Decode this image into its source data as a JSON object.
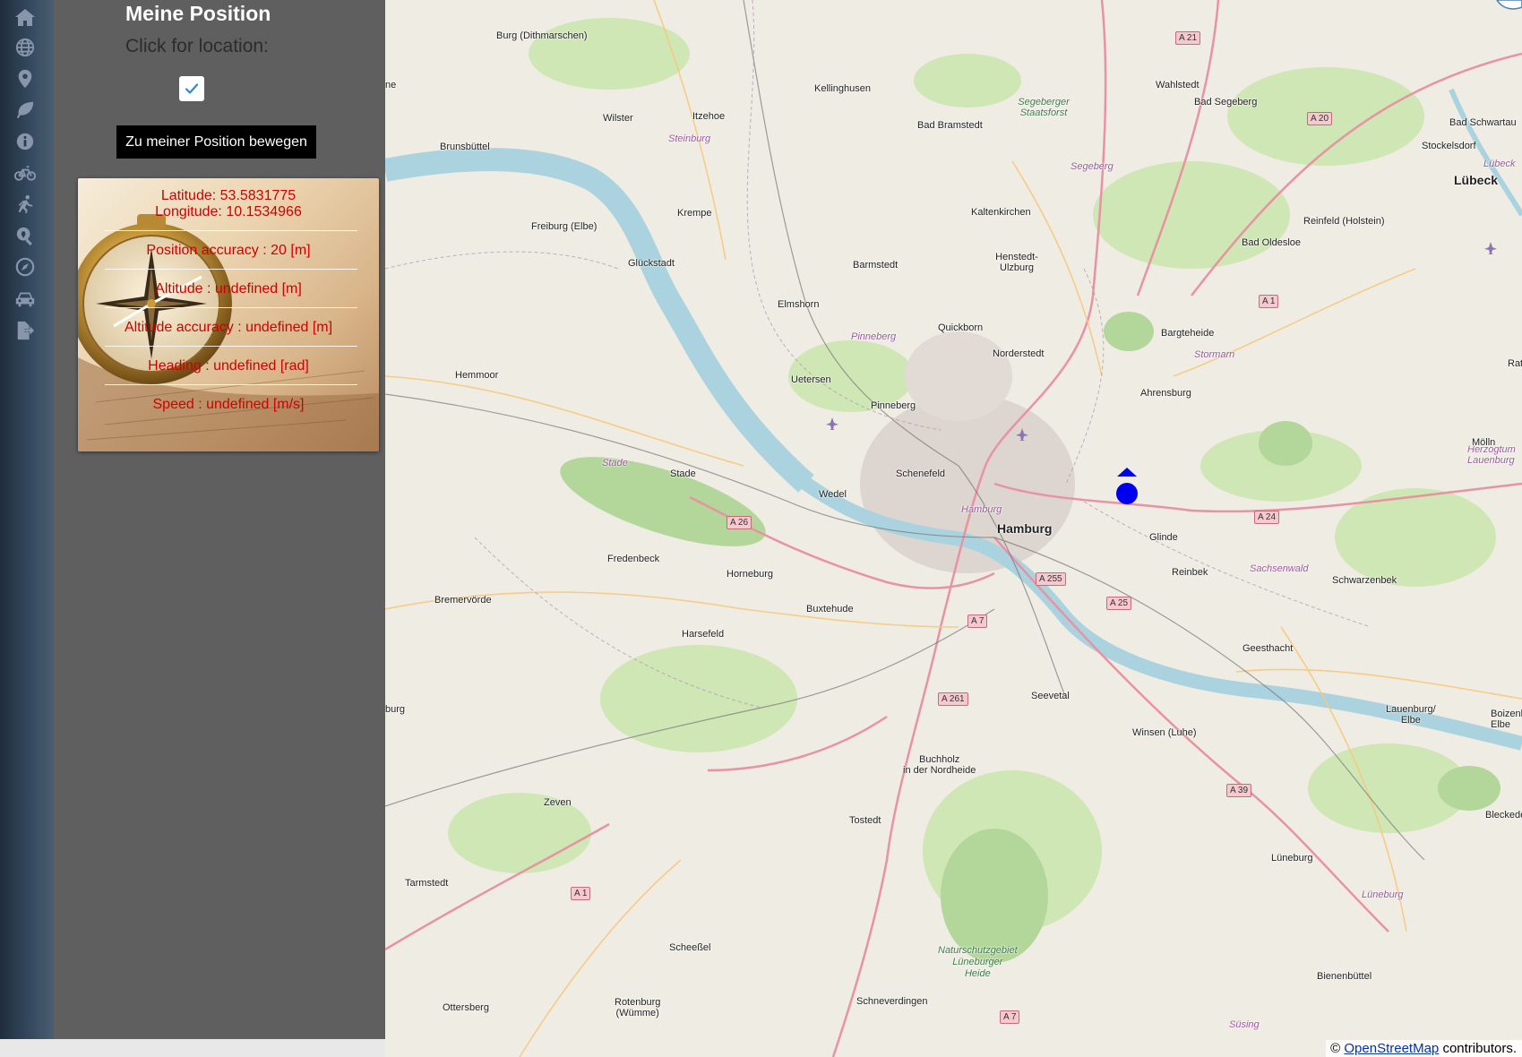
{
  "sidebar": {
    "icons": [
      {
        "name": "home-icon"
      },
      {
        "name": "globe-icon"
      },
      {
        "name": "map-marker-icon"
      },
      {
        "name": "leaf-icon"
      },
      {
        "name": "info-icon"
      },
      {
        "name": "bicycle-icon"
      },
      {
        "name": "running-icon"
      },
      {
        "name": "search-location-icon"
      },
      {
        "name": "compass-icon"
      },
      {
        "name": "car-icon"
      },
      {
        "name": "file-export-icon"
      }
    ]
  },
  "panel": {
    "title": "Meine Position",
    "click_label": "Click for location:",
    "checkbox_checked": true,
    "move_button": "Zu meiner Position bewegen",
    "latitude": "Latitude: 53.5831775",
    "longitude": "Longitude: 10.1534966",
    "accuracy": "Position accuracy : 20 [m]",
    "altitude": "Altitude : undefined [m]",
    "altitude_accuracy": "Altitude accuracy : undefined [m]",
    "heading": "Heading : undefined [rad]",
    "speed": "Speed : undefined [m/s]"
  },
  "map": {
    "attribution_prefix": "©",
    "attribution_link": "OpenStreetMap",
    "attribution_suffix": "contributors.",
    "places": {
      "burg_dithmarschen": "Burg (Dithmarschen)",
      "kellinghusen": "Kellinghusen",
      "wahlstedt": "Wahlstedt",
      "bad_segeberg": "Bad Segeberg",
      "bad_schwartau": "Bad Schwartau",
      "wilster": "Wilster",
      "itzehoe": "Itzehoe",
      "bad_bramstedt": "Bad Bramstedt",
      "segeberger_staatsforst": "Segeberger Staatsforst",
      "brunsbuttel": "Brunsbüttel",
      "steinburg": "Steinburg",
      "stockelsdorf": "Stockelsdorf",
      "segeberg": "Segeberg",
      "lubeck": "Lübeck",
      "lubeck_region": "Lübeck",
      "freiburg_elbe": "Freiburg (Elbe)",
      "krempe": "Krempe",
      "kaltenkirchen": "Kaltenkirchen",
      "reinfeld": "Reinfeld (Holstein)",
      "gluckstadt": "Glückstadt",
      "barmstedt": "Barmstedt",
      "henstedt_ulzburg": "Henstedt-\nUlzburg",
      "bad_oldesloe": "Bad Oldesloe",
      "elmshorn": "Elmshorn",
      "quickborn": "Quickborn",
      "bargteheide": "Bargteheide",
      "pinneberg_region": "Pinneberg",
      "stormarn": "Stormarn",
      "norderstedt": "Norderstedt",
      "hemmoor": "Hemmoor",
      "uetersen": "Uetersen",
      "ahrensburg": "Ahrensburg",
      "pinneberg": "Pinneberg",
      "molln": "Mölln",
      "stade_region": "Stade",
      "stade": "Stade",
      "schenefeld": "Schenefeld",
      "herzogtum_lauenburg": "Herzogtum\nLauenburg",
      "wedel": "Wedel",
      "hamburg_region": "Hamburg",
      "hamburg": "Hamburg",
      "glinde": "Glinde",
      "fredenbeck": "Fredenbeck",
      "horneburg": "Horneburg",
      "sachsenwald": "Sachsenwald",
      "reinbek": "Reinbek",
      "schwarzenbek": "Schwarzenbek",
      "bremervorde": "Bremervörde",
      "buxtehude": "Buxtehude",
      "harsefeld": "Harsefeld",
      "geesthacht": "Geesthacht",
      "seevetal": "Seevetal",
      "lauenburg_elbe": "Lauenburg/\nElbe",
      "boizenburg": "Boizenburg/\nElbe",
      "burg_left": "burg",
      "winsen": "Winsen (Luhe)",
      "buchholz": "Buchholz\nin der Nordheide",
      "zeven": "Zeven",
      "tostedt": "Tostedt",
      "bleckede": "Bleckede",
      "luneburg": "Lüneburg",
      "luneburg_region": "Lüneburg",
      "tarmstedt": "Tarmstedt",
      "nsg_heide": "Naturschutzgebiet\nLüneburger\nHeide",
      "scheessel": "Scheeßel",
      "bienenbuttel": "Bienenbüttel",
      "ottersberg": "Ottersberg",
      "rotenburg": "Rotenburg\n(Wümme)",
      "schneverdingen": "Schneverdingen",
      "susing": "Süsing",
      "rat": "Rat",
      "ne": "ne"
    },
    "shields": {
      "a21": "A 21",
      "a20": "A 20",
      "a1_north": "A 1",
      "a24": "A 24",
      "a26": "A 26",
      "a255": "A 255",
      "a25": "A 25",
      "a7_mid": "A 7",
      "a261": "A 261",
      "a39": "A 39",
      "a1_south": "A 1",
      "a7_south": "A 7"
    }
  }
}
